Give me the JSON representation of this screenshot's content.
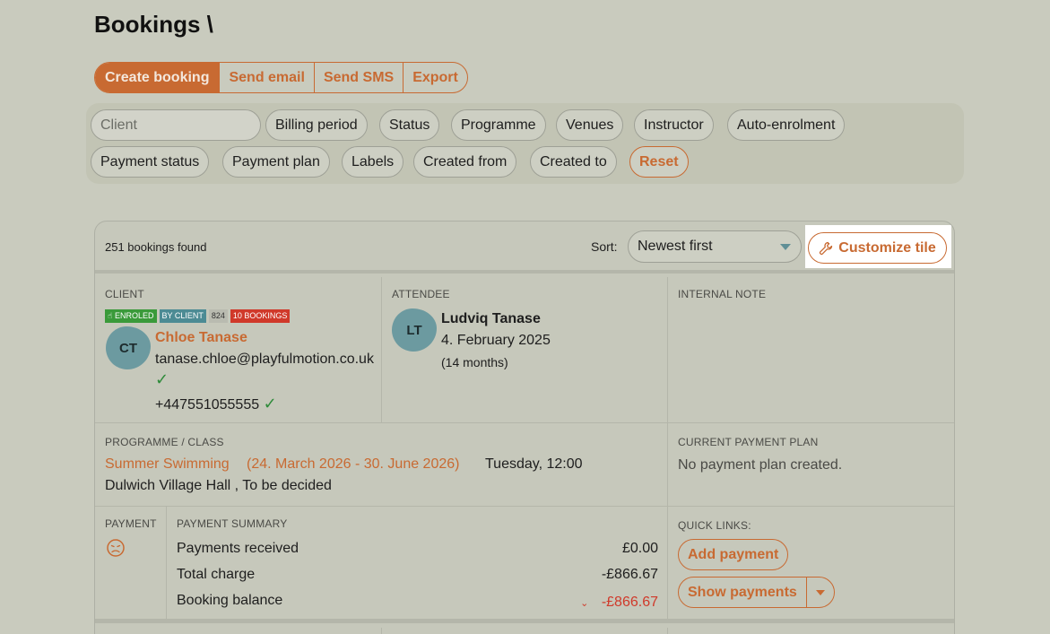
{
  "page": {
    "title": "Bookings \\"
  },
  "actions": [
    "Create booking",
    "Send email",
    "Send SMS",
    "Export"
  ],
  "filters": {
    "client_placeholder": "Client",
    "row1": [
      "Billing period",
      "Status",
      "Programme",
      "Venues",
      "Instructor",
      "Auto-enrolment"
    ],
    "row2": [
      "Payment status",
      "Payment plan",
      "Labels",
      "Created from",
      "Created to"
    ],
    "reset": "Reset"
  },
  "results": {
    "found": "251 bookings found",
    "sort_label": "Sort:",
    "sort_value": "Newest first",
    "customize": "Customize tile"
  },
  "booking": {
    "client_label": "CLIENT",
    "badges": {
      "enroled": "ENROLED",
      "by_client": "BY CLIENT",
      "count": "824",
      "bookings": "10 BOOKINGS"
    },
    "client_initials": "CT",
    "client_name": "Chloe Tanase",
    "client_email": "tanase.chloe@playfulmotion.co.uk",
    "client_phone": "+447551055555",
    "attendee_label": "ATTENDEE",
    "attendee_initials": "LT",
    "attendee_name": "Ludviq Tanase",
    "attendee_dob": "4. February 2025",
    "attendee_age": "(14 months)",
    "note_label": "INTERNAL NOTE",
    "programme_label": "PROGRAMME / CLASS",
    "programme_name": "Summer Swimming",
    "programme_dates": "(24. March 2026 - 30. June 2026)",
    "programme_time": "Tuesday, 12:00",
    "venue": "Dulwich Village Hall , To be decided",
    "plan_label": "CURRENT PAYMENT PLAN",
    "plan_value": "No payment plan created.",
    "payment_label": "PAYMENT",
    "summary_label": "PAYMENT SUMMARY",
    "received_label": "Payments received",
    "received_value": "£0.00",
    "charge_label": "Total charge",
    "charge_value": "-£866.67",
    "balance_label": "Booking balance",
    "balance_value": "-£866.67",
    "quick_label": "QUICK LINKS:",
    "add_payment": "Add payment",
    "show_payments": "Show payments"
  },
  "colors": {
    "accent": "#c86a32",
    "background": "#c9cbbe",
    "avatar": "#6c9aa0"
  }
}
